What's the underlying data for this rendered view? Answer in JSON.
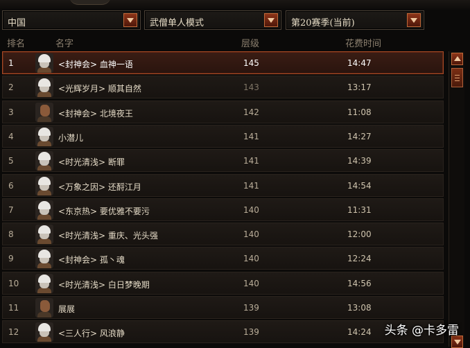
{
  "filters": {
    "region": "中国",
    "mode": "武僧单人模式",
    "season": "第20赛季(当前)"
  },
  "columns": {
    "rank": "排名",
    "name": "名字",
    "level": "层级",
    "time": "花费时间"
  },
  "rows": [
    {
      "rank": "1",
      "name": "<封神会> 血神一语",
      "level": "145",
      "time": "14:47",
      "selected": true,
      "portrait": "white-hair-monk"
    },
    {
      "rank": "2",
      "name": "<光辉岁月> 顺其自然",
      "level": "143",
      "time": "13:17",
      "portrait": "white-hair-monk"
    },
    {
      "rank": "3",
      "name": "<封神会> 北境夜王",
      "level": "142",
      "time": "11:08",
      "portrait": "bald-monk"
    },
    {
      "rank": "4",
      "name": "小潜儿",
      "level": "141",
      "time": "14:27",
      "portrait": "white-hair-monk"
    },
    {
      "rank": "5",
      "name": "<时光清浅> 断罪",
      "level": "141",
      "time": "14:39",
      "portrait": "white-hair-monk"
    },
    {
      "rank": "6",
      "name": "<万象之因> 还酹江月",
      "level": "141",
      "time": "14:54",
      "portrait": "white-hair-monk"
    },
    {
      "rank": "7",
      "name": "<东京热> 要优雅不要污",
      "level": "140",
      "time": "11:31",
      "portrait": "white-hair-monk"
    },
    {
      "rank": "8",
      "name": "<时光清浅> 重庆、光头强",
      "level": "140",
      "time": "12:00",
      "portrait": "white-hair-monk"
    },
    {
      "rank": "9",
      "name": "<封神会> 孤丶魂",
      "level": "140",
      "time": "12:24",
      "portrait": "white-hair-monk"
    },
    {
      "rank": "10",
      "name": "<时光清浅> 白日梦晚期",
      "level": "140",
      "time": "14:56",
      "portrait": "white-hair-monk"
    },
    {
      "rank": "11",
      "name": "展展",
      "level": "139",
      "time": "13:08",
      "portrait": "bald-monk"
    },
    {
      "rank": "12",
      "name": "<三人行> 风浪静",
      "level": "139",
      "time": "14:24",
      "portrait": "white-hair-monk"
    }
  ],
  "watermark": "头条 @卡多雷"
}
